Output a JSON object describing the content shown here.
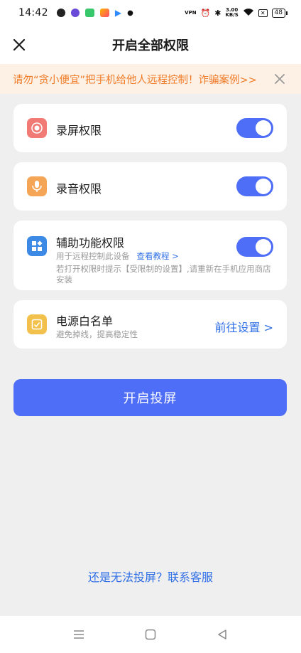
{
  "status_bar": {
    "time": "14:42",
    "net_speed_value": "3.00",
    "net_speed_unit": "KB/S",
    "battery": "48",
    "vpn": "VPN"
  },
  "header": {
    "title": "开启全部权限"
  },
  "warning": {
    "text": "请勿“贪小便宜”把手机给他人远程控制！诈骗案例>>"
  },
  "permissions": [
    {
      "title": "录屏权限",
      "enabled": true,
      "icon": "screen-record-icon",
      "color": "#f27a75"
    },
    {
      "title": "录音权限",
      "enabled": true,
      "icon": "microphone-icon",
      "color": "#f4a556"
    },
    {
      "title": "辅助功能权限",
      "subtitle": "用于远程控制此设备",
      "link": "查看教程 >",
      "note": "若打开权限时提示【受限制的设置】,请重新在手机应用商店安装",
      "enabled": true,
      "icon": "accessibility-icon",
      "color": "#3d8ae6"
    },
    {
      "title": "电源白名单",
      "subtitle": "避免掉线，提高稳定性",
      "action": "前往设置 >",
      "icon": "power-whitelist-icon",
      "color": "#f2c14b"
    }
  ],
  "primary_button": "开启投屏",
  "help_link": "还是无法投屏？联系客服",
  "colors": {
    "accent": "#4f6ef7",
    "link": "#2f6fe6",
    "warning": "#f07b27",
    "warning_bg": "#fdf0e4",
    "background": "#efefef"
  }
}
